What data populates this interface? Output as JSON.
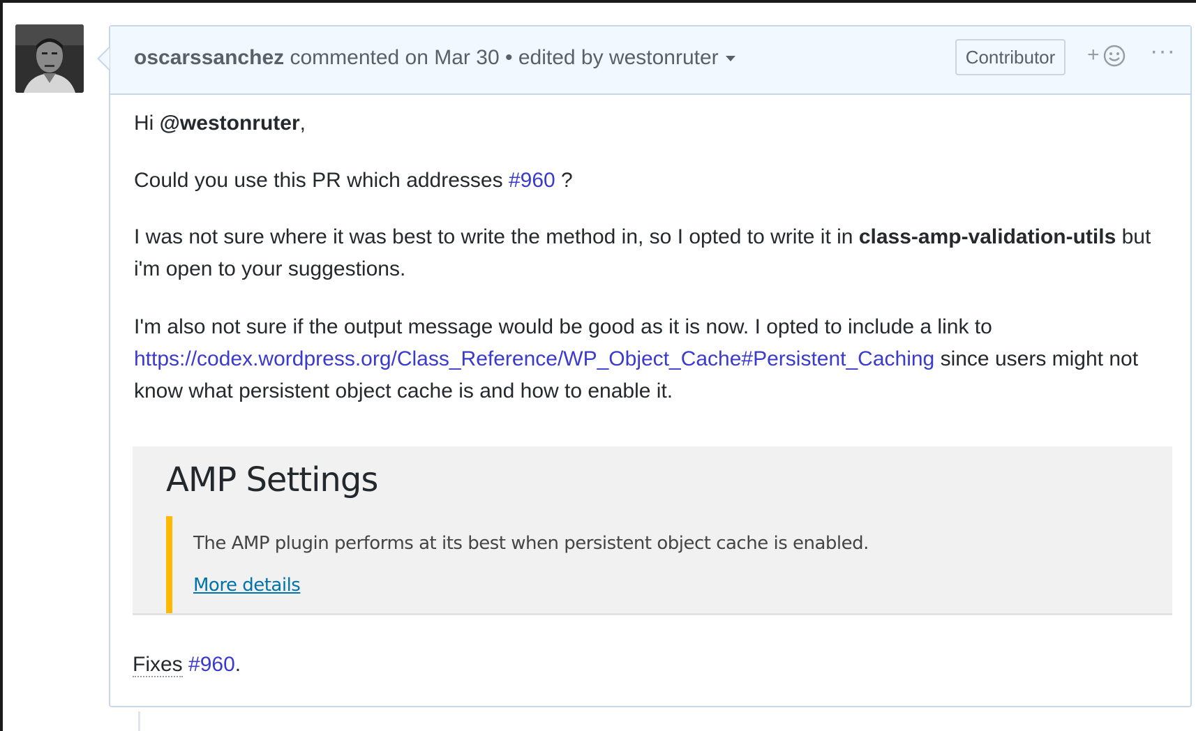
{
  "comment": {
    "author": "oscarssanchez",
    "action_text": "commented on Mar 30",
    "separator": "•",
    "edited_text": "edited by westonruter",
    "badge": "Contributor",
    "reaction_plus": "+",
    "more": "···"
  },
  "body": {
    "greeting_prefix": "Hi ",
    "mention": "@westonruter",
    "greeting_suffix": ",",
    "p2_text": "Could you use this PR which addresses ",
    "p2_link": "#960",
    "p2_suffix": " ?",
    "p3_text": "I was not sure where it was best to write the method in, so I opted to write it in ",
    "p3_bold": "class-amp-validation-utils",
    "p3_suffix": " but i'm open to your suggestions.",
    "p4_text": "I'm also not sure if the output message would be good as it is now. I opted to include a link to ",
    "p4_link": "https://codex.wordpress.org/Class_Reference/WP_Object_Cache#Persistent_Caching",
    "p4_suffix": " since users might not know what persistent object cache is and how to enable it."
  },
  "screenshot": {
    "title": "AMP Settings",
    "notice_message": "The AMP plugin performs at its best when persistent object cache is enabled.",
    "notice_link": "More details"
  },
  "fixes": {
    "label": "Fixes",
    "issue": "#960",
    "suffix": "."
  },
  "colors": {
    "header_bg": "#f1f8ff",
    "border": "#c8d7ea",
    "link": "#3a3acc",
    "notice_accent": "#ffb900",
    "wp_link": "#0073aa"
  }
}
